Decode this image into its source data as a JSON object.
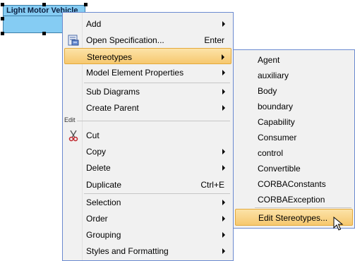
{
  "diagram": {
    "element_title": "Light Motor Vehicle"
  },
  "menu": {
    "edit_section_label": "Edit",
    "items": {
      "add": "Add",
      "open_spec": "Open Specification...",
      "open_spec_shortcut": "Enter",
      "stereotypes": "Stereotypes",
      "model_element_properties": "Model Element Properties",
      "sub_diagrams": "Sub Diagrams",
      "create_parent": "Create Parent",
      "cut": "Cut",
      "copy": "Copy",
      "delete": "Delete",
      "duplicate": "Duplicate",
      "duplicate_shortcut": "Ctrl+E",
      "selection": "Selection",
      "order": "Order",
      "grouping": "Grouping",
      "styles": "Styles and Formatting"
    }
  },
  "submenu": {
    "items": [
      "Agent",
      "auxiliary",
      "Body",
      "boundary",
      "Capability",
      "Consumer",
      "control",
      "Convertible",
      "CORBAConstants",
      "CORBAException"
    ],
    "edit_stereotypes": "Edit Stereotypes..."
  },
  "icons": {
    "open_spec": "specification-icon",
    "cut": "scissors-icon",
    "cursor": "mouse-pointer-icon"
  }
}
